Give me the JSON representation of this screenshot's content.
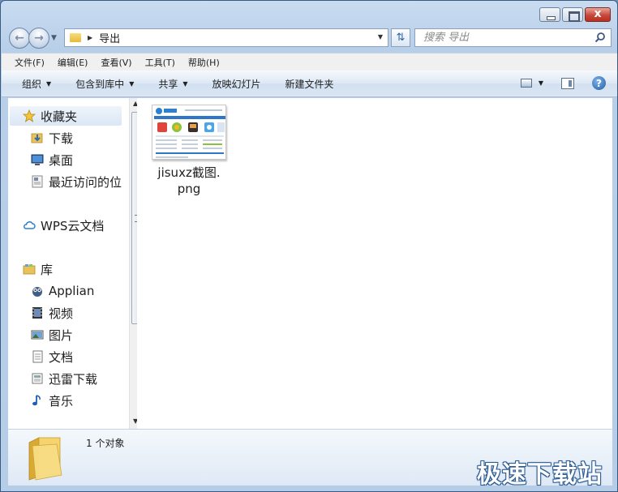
{
  "window": {
    "close_glyph": "x"
  },
  "address": {
    "path": "导出"
  },
  "search": {
    "placeholder": "搜索 导出"
  },
  "menu": [
    "文件(F)",
    "编辑(E)",
    "查看(V)",
    "工具(T)",
    "帮助(H)"
  ],
  "commands": {
    "organize": "组织",
    "include_in_library": "包含到库中",
    "share": "共享",
    "slideshow": "放映幻灯片",
    "new_folder": "新建文件夹"
  },
  "nav": {
    "favorites": {
      "label": "收藏夹",
      "icon": "star-icon"
    },
    "fav_items": [
      {
        "label": "下载",
        "icon": "download-folder-icon"
      },
      {
        "label": "桌面",
        "icon": "desktop-icon"
      },
      {
        "label": "最近访问的位",
        "icon": "recent-places-icon"
      }
    ],
    "wps": {
      "label": "WPS云文档",
      "icon": "cloud-icon"
    },
    "library": {
      "label": "库",
      "icon": "library-icon"
    },
    "lib_items": [
      {
        "label": "Applian",
        "icon": "applian-icon"
      },
      {
        "label": "视频",
        "icon": "video-icon"
      },
      {
        "label": "图片",
        "icon": "pictures-icon"
      },
      {
        "label": "文档",
        "icon": "documents-icon"
      },
      {
        "label": "迅雷下载",
        "icon": "thunder-download-icon"
      },
      {
        "label": "音乐",
        "icon": "music-icon"
      }
    ]
  },
  "files": [
    {
      "name_line1": "jisuxz截图.",
      "name_line2": "png"
    }
  ],
  "status": {
    "count": "1 个对象"
  },
  "watermark": "极速下载站",
  "colors": {
    "accent": "#2a5c93",
    "folder": "#e8c04a",
    "window_frame": "#b8cfe9"
  }
}
